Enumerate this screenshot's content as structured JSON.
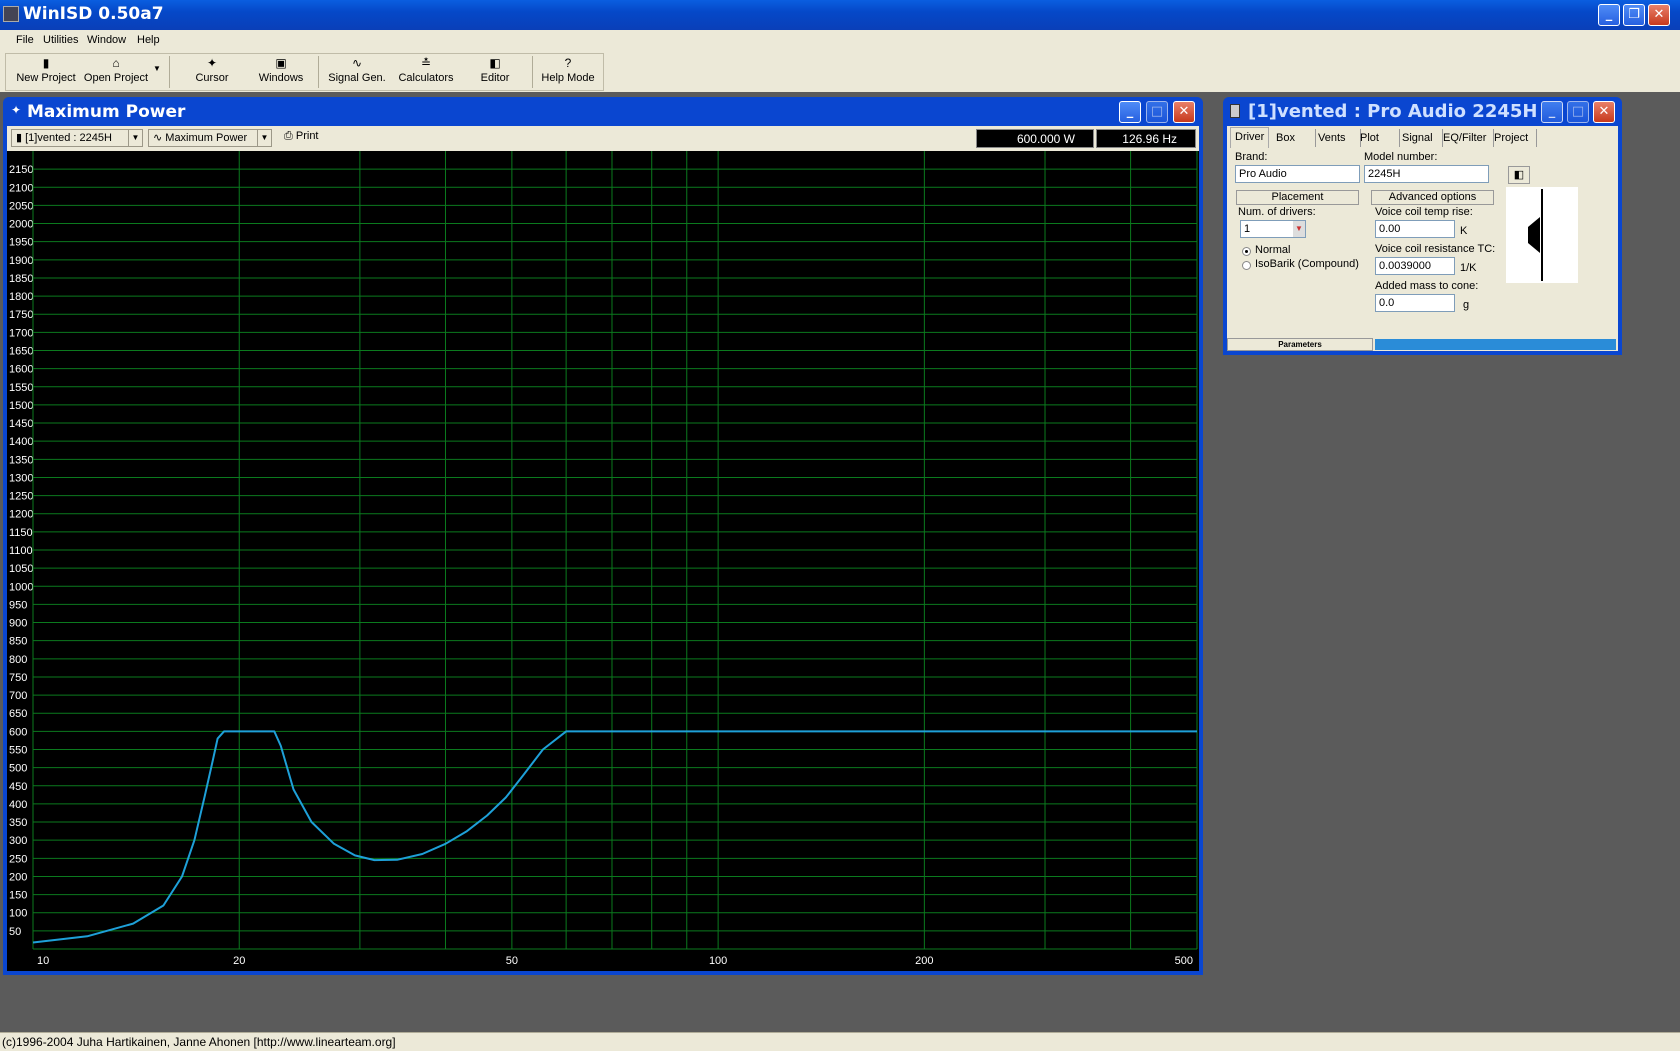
{
  "app": {
    "title": "WinISD 0.50a7"
  },
  "menu": [
    "File",
    "Utilities",
    "Window",
    "Help"
  ],
  "toolbar": [
    {
      "label": "New Project",
      "icon": "new-project-icon",
      "glyph": "▮"
    },
    {
      "label": "Open Project",
      "icon": "open-folder-icon",
      "glyph": "⌂"
    },
    {
      "label": "Cursor",
      "icon": "cursor-icon",
      "glyph": "✦"
    },
    {
      "label": "Windows",
      "icon": "windows-icon",
      "glyph": "▣"
    },
    {
      "label": "Signal Gen.",
      "icon": "signal-gen-icon",
      "glyph": "∿"
    },
    {
      "label": "Calculators",
      "icon": "calculators-icon",
      "glyph": "≛"
    },
    {
      "label": "Editor",
      "icon": "editor-icon",
      "glyph": "◧"
    },
    {
      "label": "Help Mode",
      "icon": "help-icon",
      "glyph": "?"
    }
  ],
  "plot_window": {
    "title": "Maximum Power",
    "project_combo": "[1]vented : 2245H",
    "graph_combo": "Maximum Power",
    "print_label": "Print",
    "power_readout": "600.000 W",
    "freq_readout": "126.96 Hz"
  },
  "driver_window": {
    "title": "[1]vented : Pro Audio 2245H",
    "tabs": [
      "Driver",
      "Box",
      "Vents",
      "Plot",
      "Signal",
      "EQ/Filter",
      "Project"
    ],
    "brand_label": "Brand:",
    "brand_value": "Pro Audio",
    "model_label": "Model number:",
    "model_value": "2245H",
    "placement_label": "Placement",
    "advanced_label": "Advanced options",
    "num_drivers_label": "Num. of drivers:",
    "num_drivers_value": "1",
    "normal_label": "Normal",
    "isobarik_label": "IsoBarik (Compound)",
    "vc_temp_label": "Voice coil temp rise:",
    "vc_temp_value": "0.00",
    "vc_temp_unit": "K",
    "vc_res_label": "Voice coil resistance TC:",
    "vc_res_value": "0.0039000",
    "vc_res_unit": "1/K",
    "mass_label": "Added mass to cone:",
    "mass_value": "0.0",
    "mass_unit": "g",
    "params_label": "Parameters"
  },
  "statusbar": {
    "text": "(c)1996-2004 Juha Hartikainen, Janne Ahonen [http://www.linearteam.org]"
  },
  "chart_data": {
    "type": "line",
    "xscale": "log",
    "xlim": [
      10,
      500
    ],
    "ylim": [
      0,
      2200
    ],
    "grid": true,
    "xticks": [
      10,
      20,
      50,
      100,
      200,
      500
    ],
    "ytick_step": 50,
    "series": [
      {
        "color": "#1ea0d8",
        "x": [
          10,
          12,
          14,
          15.5,
          16.5,
          17.2,
          17.8,
          18.3,
          18.6,
          19.0,
          22.5,
          23.0,
          24.0,
          25.5,
          27.5,
          29.5,
          31.5,
          34,
          37,
          40,
          43,
          46,
          49,
          52,
          55.5,
          60,
          80,
          120,
          200,
          300,
          500
        ],
        "y": [
          18,
          35,
          70,
          120,
          200,
          300,
          420,
          520,
          580,
          600,
          600,
          560,
          440,
          350,
          290,
          258,
          245,
          246,
          262,
          290,
          325,
          368,
          418,
          480,
          550,
          600,
          600,
          600,
          600,
          600,
          600
        ]
      }
    ]
  }
}
